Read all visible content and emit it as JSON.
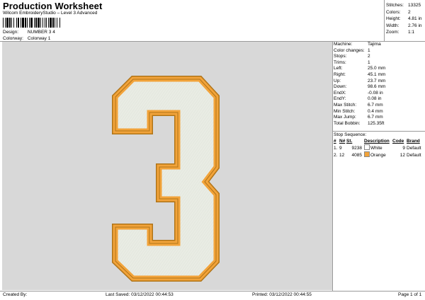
{
  "header": {
    "title": "Production Worksheet",
    "subtitle": "Wilcom EmbroideryStudio – Level 3 Advanced"
  },
  "design": {
    "design_label": "Design:",
    "design_value": "NUMBER 3 4",
    "colorway_label": "Colorway:",
    "colorway_value": "Colorway 1"
  },
  "stats": [
    {
      "label": "Stitches:",
      "value": "13325"
    },
    {
      "label": "Colors:",
      "value": "2"
    },
    {
      "label": "Height:",
      "value": "4.81 in"
    },
    {
      "label": "Width:",
      "value": "2.76 in"
    },
    {
      "label": "Zoom:",
      "value": "1:1"
    }
  ],
  "machine_info": [
    {
      "label": "Machine:",
      "value": "Tajima"
    },
    {
      "label": "Color changes:",
      "value": "1"
    },
    {
      "label": "Stops:",
      "value": "2"
    },
    {
      "label": "Trims:",
      "value": "1"
    },
    {
      "label": "Left:",
      "value": "25.0 mm"
    },
    {
      "label": "Right:",
      "value": "45.1 mm"
    },
    {
      "label": "Up:",
      "value": "23.7 mm"
    },
    {
      "label": "Down:",
      "value": "98.6 mm"
    },
    {
      "label": "EndX:",
      "value": "-0.08 in"
    },
    {
      "label": "EndY:",
      "value": "0.08 in"
    },
    {
      "label": "Max Stitch:",
      "value": "6.7 mm"
    },
    {
      "label": "Min Stitch:",
      "value": "0.4 mm"
    },
    {
      "label": "Max Jump:",
      "value": "6.7 mm"
    },
    {
      "label": "Total Bobbin:",
      "value": "125.35ft"
    }
  ],
  "stop_sequence": {
    "title": "Stop Sequence:",
    "headers": [
      "#",
      "N#",
      "St.",
      "Description",
      "Code",
      "Brand"
    ],
    "rows": [
      {
        "num": "1.",
        "n": "9",
        "st": "9238",
        "description": "White",
        "code": "9",
        "brand": "Default",
        "color": "#ffffff"
      },
      {
        "num": "2.",
        "n": "12",
        "st": "4085",
        "description": "Orange",
        "code": "12",
        "brand": "Default",
        "color": "#f2a33a"
      }
    ]
  },
  "footer": {
    "created_by": "Created By:",
    "last_saved": "Last Saved: 03/12/2022 00:44:53",
    "printed": "Printed: 03/12/2022 00:44:55",
    "page": "Page 1 of 1"
  },
  "colors": {
    "fill": "#e9ece4",
    "outline": "#f2a33a",
    "outline_dark": "#b07418",
    "canvas": "#d8d8d8"
  }
}
